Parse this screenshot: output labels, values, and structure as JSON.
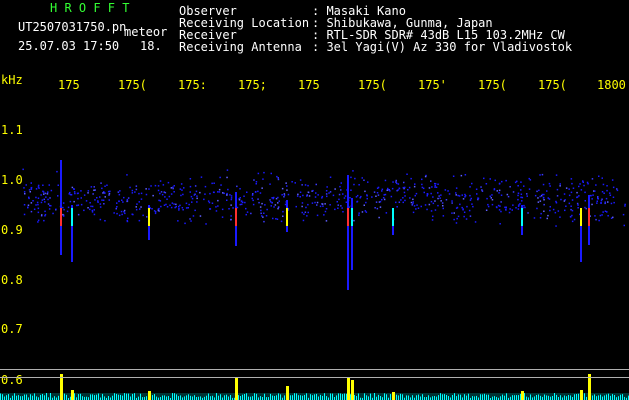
{
  "header": {
    "title": "H R O F F T",
    "filename": "UT2507031750.pn",
    "meteor_label": "meteor",
    "timestamp": "25.07.03 17:50",
    "counter": "18.",
    "info": [
      {
        "key": "Observer",
        "value": ": Masaki Kano"
      },
      {
        "key": "Receiving Location",
        "value": ": Shibukawa, Gunma, Japan"
      },
      {
        "key": "Receiver",
        "value": ": RTL-SDR SDR# 43dB L15 103.2MHz CW"
      },
      {
        "key": "Receiving Antenna",
        "value": ": 3el Yagi(V) Az 330 for Vladivostok"
      }
    ]
  },
  "axis": {
    "unit": "kHz",
    "time_ticks": [
      "175",
      "175(",
      "175:",
      "175;",
      "175",
      "175(",
      "175'",
      "175(",
      "175(",
      "1800"
    ],
    "freq_labels": [
      "1.1",
      "1.0",
      "0.9",
      "0.8",
      "0.7",
      "0.6"
    ]
  },
  "colors": {
    "background": "#000000",
    "text": "#ffffff",
    "labels": "#ffff00",
    "title": "#33ff33",
    "noise": "#1a1aff",
    "echo_hot": "#ff3030",
    "echo_warm": "#ffff00",
    "echo_cool": "#00ffff",
    "baseline": "#00ffff"
  }
}
